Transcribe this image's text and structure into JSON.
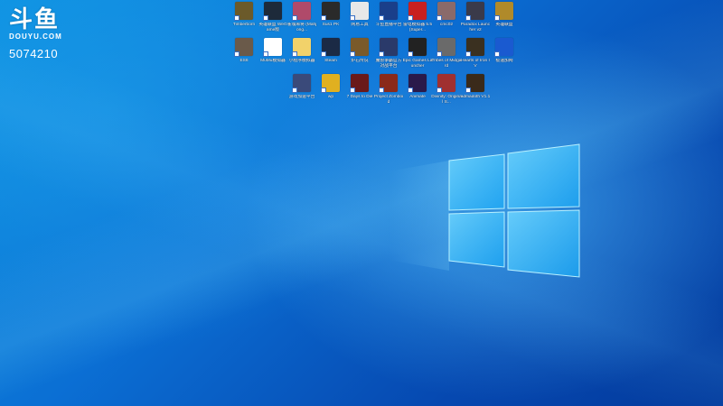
{
  "watermark": {
    "brand": "斗鱼",
    "domain": "DOUYU.COM",
    "room_id": "5074210"
  },
  "desktop_icons": [
    {
      "label": "Timberborn",
      "color": "#6b5a2a",
      "icon": "game-icon"
    },
    {
      "label": "英雄联盟 WeGame版",
      "color": "#1d2a3a",
      "icon": "league-icon"
    },
    {
      "label": "雀魂麻将 (Mahjong...",
      "color": "#b04a6a",
      "icon": "mahjong-icon"
    },
    {
      "label": "Sus1 PK",
      "color": "#2a2a2a",
      "icon": "pk-icon"
    },
    {
      "label": "网易工具",
      "color": "#e8e8e8",
      "icon": "tool-icon"
    },
    {
      "label": "斗鱼直播平台",
      "color": "#1a3f8a",
      "icon": "douyu-icon"
    },
    {
      "label": "雷电模拟器 5.5(Super...",
      "color": "#c82020",
      "icon": "flash-icon"
    },
    {
      "label": "cmc02",
      "color": "#8a6a6a",
      "icon": "app-icon"
    },
    {
      "label": "Paradox Launcher v2",
      "color": "#3a3a4a",
      "icon": "paradox-icon"
    },
    {
      "label": "英雄联盟",
      "color": "#b08a2a",
      "icon": "league-icon"
    },
    {
      "label": "ES6",
      "color": "#6a5a4a",
      "icon": "game-icon"
    },
    {
      "label": "MuMu模拟器",
      "color": "#ffffff",
      "icon": "mumu-icon"
    },
    {
      "label": "小程序模拟器",
      "color": "#f2d26a",
      "icon": "app-icon"
    },
    {
      "label": "Steam",
      "color": "#1b2a45",
      "icon": "steam-icon"
    },
    {
      "label": "炉石传说",
      "color": "#7a5a2a",
      "icon": "hearthstone-icon"
    },
    {
      "label": "魔兽争霸官方 对战平台",
      "color": "#2a3a6a",
      "icon": "warcraft-icon"
    },
    {
      "label": "Epic Games Launcher",
      "color": "#222222",
      "icon": "epic-icon"
    },
    {
      "label": "Tribes of Midgard",
      "color": "#6a6a6a",
      "icon": "game-icon"
    },
    {
      "label": "Hearts of Iron IV",
      "color": "#3a3020",
      "icon": "game-icon"
    },
    {
      "label": "极速加网",
      "color": "#1a5ad0",
      "icon": "network-icon"
    },
    {
      "label": "游戏加速平台",
      "color": "#3a4a7a",
      "icon": "booster-icon"
    },
    {
      "label": "wp",
      "color": "#e0b020",
      "icon": "star-icon"
    },
    {
      "label": "7 Days to Die",
      "color": "#6a1a1a",
      "icon": "game-icon"
    },
    {
      "label": "Project Zomboid",
      "color": "#8a2a1a",
      "icon": "game-icon"
    },
    {
      "label": "Animate",
      "color": "#2a1a4a",
      "icon": "animate-icon"
    },
    {
      "label": "Divinity: Original S...",
      "color": "#a03030",
      "icon": "game-icon"
    },
    {
      "label": "admadoth V1.1",
      "color": "#3a2a1a",
      "icon": "game-icon"
    }
  ]
}
